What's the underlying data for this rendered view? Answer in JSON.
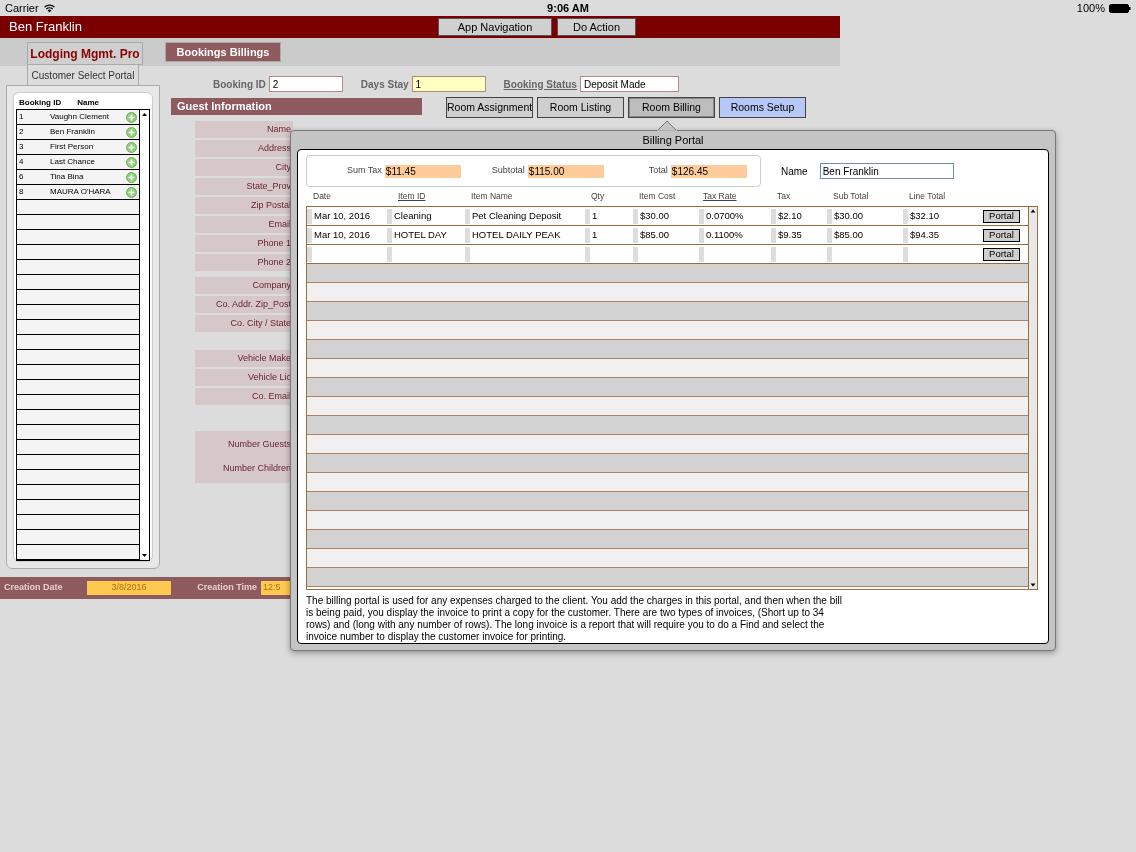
{
  "status_bar": {
    "carrier": "Carrier",
    "time": "9:06 AM",
    "battery": "100%"
  },
  "header": {
    "title": "Ben Franklin",
    "buttons": [
      "App Navigation",
      "Do Action"
    ]
  },
  "app_tab": "Lodging Mgmt. Pro",
  "portal_tab": "Customer Select Portal",
  "customer_list": {
    "columns": [
      "Booking ID",
      "Name"
    ],
    "rows": [
      {
        "id": "1",
        "name": "Vaughn Clement"
      },
      {
        "id": "2",
        "name": "Ben Franklin"
      },
      {
        "id": "3",
        "name": "First Person"
      },
      {
        "id": "4",
        "name": "Last Chance"
      },
      {
        "id": "6",
        "name": "Tina Bina"
      },
      {
        "id": "8",
        "name": "MAURA O'HARA"
      }
    ]
  },
  "layout_tab": "Bookings Billings",
  "booking_fields": [
    {
      "label": "Booking ID",
      "value": "2",
      "highlighted": false,
      "underlined": false
    },
    {
      "label": "Days Stay",
      "value": "1",
      "highlighted": true,
      "underlined": false
    },
    {
      "label": "Booking Status",
      "value": "Deposit Made",
      "highlighted": false,
      "underlined": true
    }
  ],
  "guest_info": {
    "title": "Guest Information",
    "groups": [
      {
        "labels": [
          "Name",
          "Address",
          "City",
          "State_Prov",
          "Zip Postal",
          "Email",
          "Phone 1",
          "Phone 2"
        ]
      },
      {
        "labels": [
          "Company",
          "Co. Addr. Zip_Post",
          "Co.  City / State"
        ]
      },
      {
        "labels": [
          "Vehicle Make",
          "Vehicle Lic",
          "Co. Email"
        ]
      },
      {
        "labels": [
          "Number Guests",
          "Number Children"
        ]
      }
    ]
  },
  "nav_buttons": [
    {
      "label": "Room Assignment",
      "selected": false,
      "highlighted": false
    },
    {
      "label": "Room Listing",
      "selected": false,
      "highlighted": false
    },
    {
      "label": "Room Billing",
      "selected": true,
      "highlighted": false
    },
    {
      "label": "Rooms Setup",
      "selected": false,
      "highlighted": true
    }
  ],
  "billing_portal": {
    "title": "Billing Portal",
    "summary": [
      {
        "label": "Sum Tax",
        "value": "$11.45"
      },
      {
        "label": "Subtotal",
        "value": "$115.00"
      },
      {
        "label": "Total",
        "value": "$126.45"
      }
    ],
    "name": {
      "label": "Name",
      "value": "Ben Franklin"
    },
    "columns": [
      {
        "label": "Date",
        "underlined": false
      },
      {
        "label": "Item ID",
        "underlined": true
      },
      {
        "label": "Item Name",
        "underlined": false
      },
      {
        "label": "Qty",
        "underlined": false
      },
      {
        "label": "Item Cost",
        "underlined": false
      },
      {
        "label": "Tax Rate",
        "underlined": true
      },
      {
        "label": "Tax",
        "underlined": false
      },
      {
        "label": "Sub Total",
        "underlined": false
      },
      {
        "label": "Line Total",
        "underlined": false
      }
    ],
    "rows": [
      {
        "cells": [
          "Mar 10, 2016",
          "Cleaning",
          "Pet Cleaning Deposit",
          "1",
          "$30.00",
          "0.0700%",
          "$2.10",
          "$30.00",
          "$32.10"
        ],
        "button": "Portal"
      },
      {
        "cells": [
          "Mar 10, 2016",
          "HOTEL DAY",
          "HOTEL DAILY PEAK",
          "1",
          "$85.00",
          "0.1100%",
          "$9.35",
          "$85.00",
          "$94.35"
        ],
        "button": "Portal"
      },
      {
        "button": "Portal"
      }
    ],
    "description": "The billing portal is used for any expenses charged to the client. You add the charges in this portal, and then when the bill is being paid, you display the invoice to print a copy for the customer. There are two types of invoices, (Short up to 34 rows) and (long with any number of rows). The long invoice is a report that will require you to do a Find and select the invoice number to display the customer invoice for printing."
  },
  "footer": [
    {
      "label": "Creation Date",
      "value": "3/8/2016"
    },
    {
      "label": "Creation Time",
      "value": "12:5"
    }
  ]
}
